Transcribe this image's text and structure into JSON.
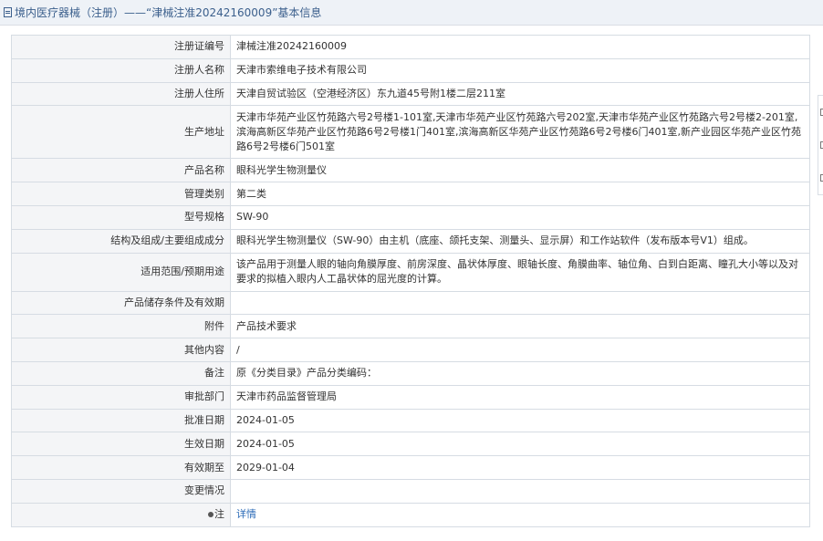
{
  "header": {
    "title": "境内医疗器械（注册）——“津械注准20242160009”基本信息"
  },
  "details": [
    {
      "label": "注册证编号",
      "value": "津械注准20242160009"
    },
    {
      "label": "注册人名称",
      "value": "天津市索维电子技术有限公司"
    },
    {
      "label": "注册人住所",
      "value": "天津自贸试验区（空港经济区）东九道45号附1楼二层211室"
    },
    {
      "label": "生产地址",
      "value": "天津市华苑产业区竹苑路六号2号楼1-101室,天津市华苑产业区竹苑路六号202室,天津市华苑产业区竹苑路六号2号楼2-201室,滨海高新区华苑产业区竹苑路6号2号楼1门401室,滨海高新区华苑产业区竹苑路6号2号楼6门401室,新产业园区华苑产业区竹苑路6号2号楼6门501室"
    },
    {
      "label": "产品名称",
      "value": "眼科光学生物测量仪"
    },
    {
      "label": "管理类别",
      "value": "第二类"
    },
    {
      "label": "型号规格",
      "value": "SW-90"
    },
    {
      "label": "结构及组成/主要组成成分",
      "value": "眼科光学生物测量仪（SW-90）由主机（底座、颌托支架、测量头、显示屏）和工作站软件（发布版本号V1）组成。"
    },
    {
      "label": "适用范围/预期用途",
      "value": "该产品用于测量人眼的轴向角膜厚度、前房深度、晶状体厚度、眼轴长度、角膜曲率、轴位角、白到白距离、瞳孔大小等以及对要求的拟植入眼内人工晶状体的屈光度的计算。"
    },
    {
      "label": "产品储存条件及有效期",
      "value": ""
    },
    {
      "label": "附件",
      "value": "产品技术要求"
    },
    {
      "label": "其他内容",
      "value": "/"
    },
    {
      "label": "备注",
      "value": "原《分类目录》产品分类编码："
    },
    {
      "label": "审批部门",
      "value": "天津市药品监督管理局"
    },
    {
      "label": "批准日期",
      "value": "2024-01-05"
    },
    {
      "label": "生效日期",
      "value": "2024-01-05"
    },
    {
      "label": "有效期至",
      "value": "2029-01-04"
    },
    {
      "label": "变更情况",
      "value": ""
    },
    {
      "label": "注",
      "value": "详情"
    }
  ],
  "icons": {
    "title": "document-icon",
    "note": "pin-icon"
  },
  "colors": {
    "title_text": "#3b5f8c",
    "link": "#2a6ab7",
    "label_bg": "#f4f5f7"
  }
}
